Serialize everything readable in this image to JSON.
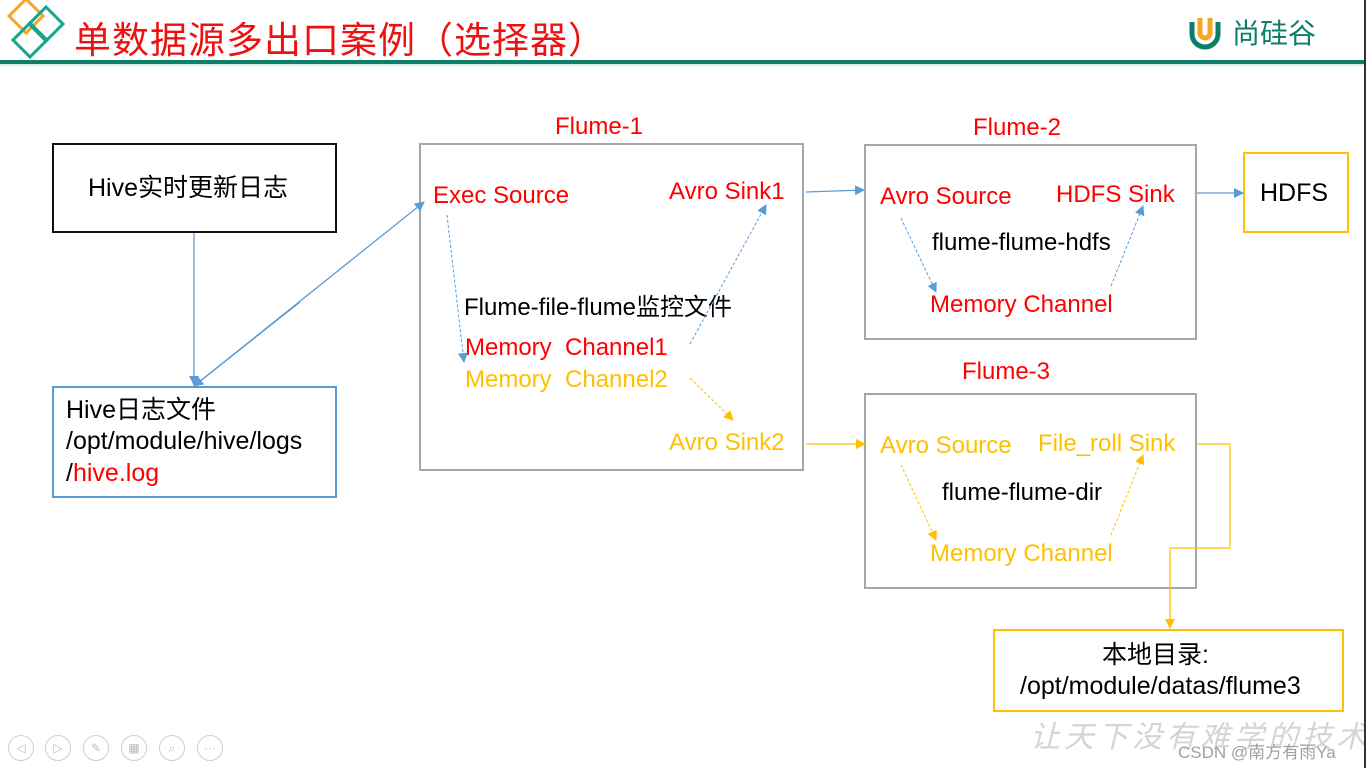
{
  "header": {
    "title": "单数据源多出口案例（选择器）",
    "logo_text": "尚硅谷",
    "accent_color": "#0b7f68",
    "title_color": "#ff0000"
  },
  "diagram": {
    "hive_realtime_box": {
      "label": "Hive实时更新日志"
    },
    "hive_log_box": {
      "line1": "Hive日志文件",
      "line2": "/opt/module/hive/logs",
      "line3_prefix": "/",
      "line3_highlight": "hive.log"
    },
    "flume1": {
      "title": "Flume-1",
      "source": "Exec Source",
      "sink1": "Avro Sink1",
      "sink2": "Avro Sink2",
      "description": "Flume-file-flume监控文件",
      "channel1": "Memory  Channel1",
      "channel2": "Memory  Channel2"
    },
    "flume2": {
      "title": "Flume-2",
      "source": "Avro Source",
      "sink": "HDFS Sink",
      "description": "flume-flume-hdfs",
      "channel": "Memory Channel"
    },
    "flume3": {
      "title": "Flume-3",
      "source": "Avro Source",
      "sink": "File_roll Sink",
      "description": "flume-flume-dir",
      "channel": "Memory Channel"
    },
    "hdfs_box": {
      "label": "HDFS"
    },
    "local_dir_box": {
      "line1": "本地目录:",
      "line2": "/opt/module/datas/flume3"
    },
    "colors": {
      "red": "#ff0000",
      "gold": "#ffc000",
      "blue": "#5b9bd5",
      "gray": "#a6a6a6"
    }
  },
  "footer": {
    "nav_buttons": [
      {
        "icon": "previous-icon",
        "glyph": "◁"
      },
      {
        "icon": "next-icon",
        "glyph": "▷"
      },
      {
        "icon": "pen-icon",
        "glyph": "✎"
      },
      {
        "icon": "slides-icon",
        "glyph": "▦"
      },
      {
        "icon": "zoom-icon",
        "glyph": "⌕"
      },
      {
        "icon": "more-icon",
        "glyph": "···"
      }
    ],
    "watermark": "让天下没有难学的技术",
    "credit": "CSDN @南方有雨Ya"
  }
}
